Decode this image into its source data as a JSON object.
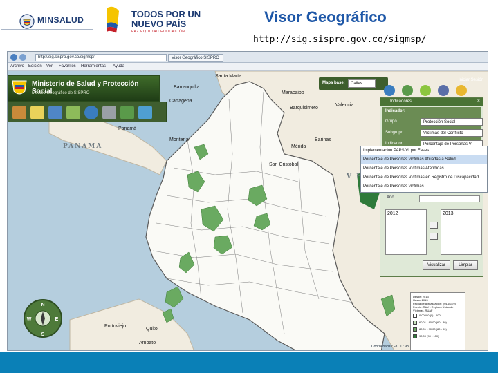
{
  "header": {
    "ministry_logo_text": "MINSALUD",
    "gov_slogan_line1": "TODOS POR UN",
    "gov_slogan_line2": "NUEVO PAÍS",
    "gov_slogan_line3": "PAZ EQUIDAD EDUCACIÓN",
    "title": "Visor Geográfico",
    "url": "http://sig.sispro.gov.co/sigmsp/"
  },
  "browser": {
    "address": "http://sig.sispro.gov.co/sigmsp/",
    "tab": "Visor Geográfico SISPRO",
    "menu": [
      "Archivo",
      "Edición",
      "Ver",
      "Favoritos",
      "Herramientas",
      "Ayuda"
    ]
  },
  "app": {
    "banner_title": "Ministerio de Salud y Protección Social",
    "banner_subtitle": "Módulo Geográfico de SISPRO",
    "basemap_label": "Mapa base:",
    "basemap_value": "Calles",
    "login": "Iniciar Sesión"
  },
  "panel": {
    "header": "Indicadores",
    "section": "Indicador:",
    "rows": [
      {
        "label": "Grupo",
        "value": "Protección Social"
      },
      {
        "label": "Subgrupo",
        "value": "Víctimas del Conflicto"
      },
      {
        "label": "Indicador",
        "value": "Porcentaje de Personas V"
      }
    ],
    "dropdown": [
      "Implementación PAPSIVI por Fases",
      "Porcentaje de Personas víctimas Afiliadas a Salud",
      "Porcentaje de Personas Víctimas Atendidas",
      "Porcentaje de Personas Víctimas en Registro de Discapacidad",
      "Porcentaje de Personas víctimas"
    ],
    "dropdown_selected": 1,
    "year_label": "Año",
    "year_available": "2012",
    "year_selected": "2013",
    "btn_view": "Visualizar",
    "btn_clear": "Limpiar"
  },
  "legend": {
    "lines": [
      "Desde: 2013",
      "Hasta: 2013",
      "Fecha de actualización: 2014/02/20",
      "Fuente: RUV - Registro Único de",
      "Víctimas, RUAF"
    ],
    "items": [
      {
        "label": "0,00000 (0) - 600",
        "color": "#ffffff"
      },
      {
        "label": "60,01 - 80,00 (60 - 80)",
        "color": "#c9e4bf"
      },
      {
        "label": "80,01 - 90,00 (80 - 90)",
        "color": "#6aaa61"
      },
      {
        "label": "90,00 (90 - 100)",
        "color": "#2f7a3a"
      }
    ],
    "coords_label": "Coordenadas: -81 17 93"
  },
  "map_labels": {
    "sea_panama": "PANAMA",
    "venezuela": "V E",
    "cities": [
      "Barranquilla",
      "Cartagena",
      "Santa Marta",
      "Maracaibo",
      "Barquisimeto",
      "Valencia",
      "Panamá",
      "Mérida",
      "Barinas",
      "San Cristóbal",
      "Quito",
      "Ambato",
      "Portoviejo",
      "Montería"
    ]
  },
  "compass": {
    "n": "N",
    "s": "S",
    "e": "E",
    "w": "W"
  },
  "colors": {
    "title": "#1f58a8",
    "bottom_bar": "#0a80b7",
    "panel_header": "#4a7335"
  }
}
